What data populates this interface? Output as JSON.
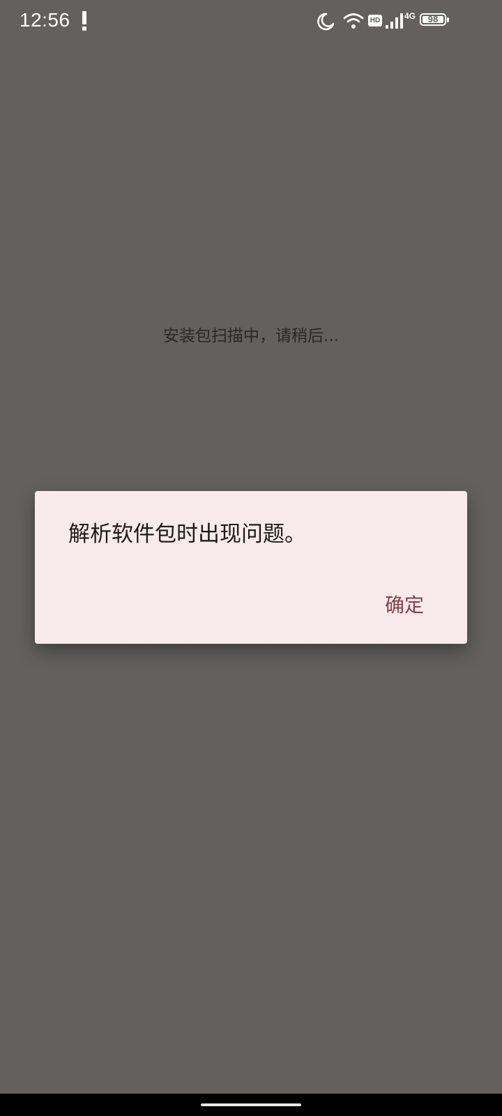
{
  "status_bar": {
    "time": "12:56",
    "icons": [
      "alert-icon",
      "dnd-moon-icon",
      "wifi-icon",
      "hd-icon",
      "signal-icon",
      "4g-icon",
      "battery-icon"
    ],
    "hd_label": "HD",
    "network_label": "4G",
    "battery_level": "98"
  },
  "background": {
    "message": "安装包扫描中，请稍后..."
  },
  "dialog": {
    "message": "解析软件包时出现问题。",
    "ok_label": "确定",
    "button_color": "#8b3d47",
    "background_color": "#f9ebeb"
  },
  "colors": {
    "scrim": "#63605f",
    "nav_bar": "#000000"
  }
}
